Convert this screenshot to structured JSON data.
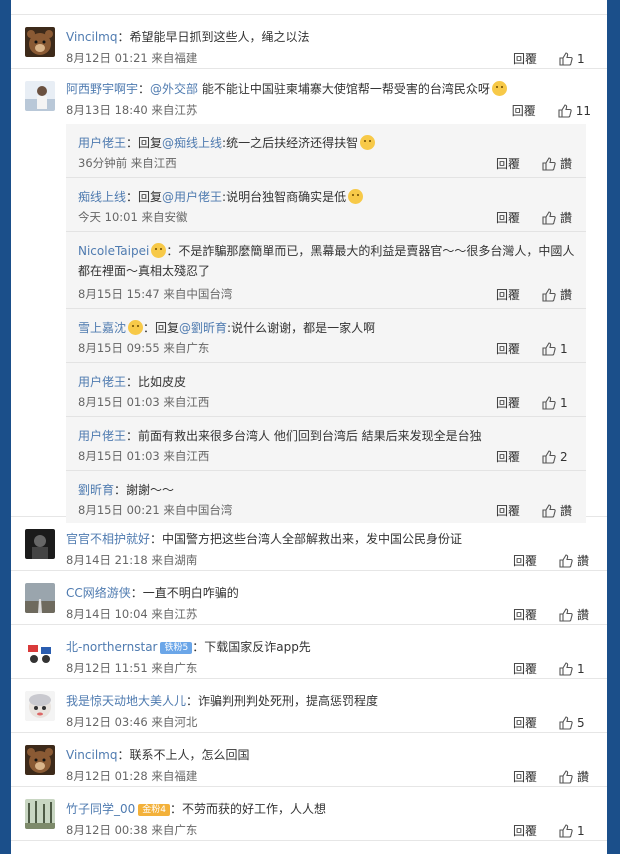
{
  "ui": {
    "reply_label": "回覆"
  },
  "top_comments_before": [
    {
      "user": "Vincilmq",
      "text": "：希望能早日抓到这些人，绳之以法",
      "time": "8月12日 01:21",
      "loc": "来自福建",
      "likes": "1",
      "avatar": "bear"
    }
  ],
  "main_thread": {
    "user": "阿西野宇啊宇",
    "text_pre": "：",
    "mention": "@外交部",
    "text": " 能不能让中国驻柬埔寨大使馆帮一帮受害的台湾民众呀",
    "emoji": "cry",
    "time": "8月13日 18:40",
    "loc": "来自江苏",
    "likes": "11",
    "avatar": "person",
    "replies": [
      {
        "user": "用户佬王",
        "prefix": "：回复",
        "mention": "@痴线上线",
        "text": ":统一之后扶经济还得扶智",
        "emoji": "wink",
        "time": "36分钟前",
        "loc": "来自江西",
        "likes": "讚"
      },
      {
        "user": "痴线上线",
        "prefix": "：回复",
        "mention": "@用户佬王",
        "text": ":说明台独智商确实是低",
        "emoji": "laugh",
        "time": "今天 10:01",
        "loc": "来自安徽",
        "likes": "讚"
      },
      {
        "user": "NicoleTaipei",
        "badge_emoji": true,
        "prefix": "",
        "mention": "",
        "text": "：不是詐騙那麼簡單而已，黑幕最大的利益是賣器官～～很多台灣人，中國人",
        "text2": "都在裡面～真相太殘忍了",
        "time": "8月15日 15:47",
        "loc": "来自中国台湾",
        "likes": "讚"
      },
      {
        "user": "雪上嘉沈",
        "badge_emoji": true,
        "prefix": "：回复",
        "mention": "@劉昕育",
        "text": ":说什么谢谢，都是一家人啊",
        "time": "8月15日 09:55",
        "loc": "来自广东",
        "likes": "1"
      },
      {
        "user": "用户佬王",
        "prefix": "",
        "mention": "",
        "text": "：比如皮皮",
        "time": "8月15日 01:03",
        "loc": "来自江西",
        "likes": "1"
      },
      {
        "user": "用户佬王",
        "prefix": "",
        "mention": "",
        "text": "：前面有救出来很多台湾人 他们回到台湾后 結果后来发现全是台独",
        "time": "8月15日 01:03",
        "loc": "来自江西",
        "likes": "2"
      },
      {
        "user": "劉昕育",
        "prefix": "",
        "mention": "",
        "text": "：謝謝～～",
        "time": "8月15日 00:21",
        "loc": "来自中国台湾",
        "likes": "讚"
      }
    ]
  },
  "comments_after": [
    {
      "user": "官官不相护就好",
      "text": "：中国警方把这些台湾人全部解救出来，发中国公民身份证",
      "time": "8月14日 21:18",
      "loc": "来自湖南",
      "likes": "讚",
      "avatar": "dark"
    },
    {
      "user": "CC网络游侠",
      "text": "：一直不明白咋骗的",
      "time": "8月14日 10:04",
      "loc": "来自江苏",
      "likes": "讚",
      "avatar": "road"
    },
    {
      "user": "北-northernstar",
      "badge": "铁粉5",
      "badge_color": "blue",
      "text": "：下载国家反诈app先",
      "time": "8月12日 11:51",
      "loc": "来自广东",
      "likes": "1",
      "avatar": "flags"
    },
    {
      "user": "我是惊天动地大美人儿",
      "text": "：诈骗判刑判处死刑，提高惩罚程度",
      "time": "8月12日 03:46",
      "loc": "来自河北",
      "likes": "5",
      "avatar": "cartoon"
    },
    {
      "user": "Vincilmq",
      "text": "：联系不上人，怎么回国",
      "time": "8月12日 01:28",
      "loc": "来自福建",
      "likes": "讚",
      "avatar": "bear"
    },
    {
      "user": "竹子同学_00",
      "badge": "金粉4",
      "badge_color": "gold",
      "text": "：不劳而获的好工作，人人想",
      "time": "8月12日 00:38",
      "loc": "来自广东",
      "likes": "1",
      "avatar": "forest"
    }
  ],
  "colors": {
    "link": "#4f7bb0",
    "background": "#1b4f8a"
  }
}
